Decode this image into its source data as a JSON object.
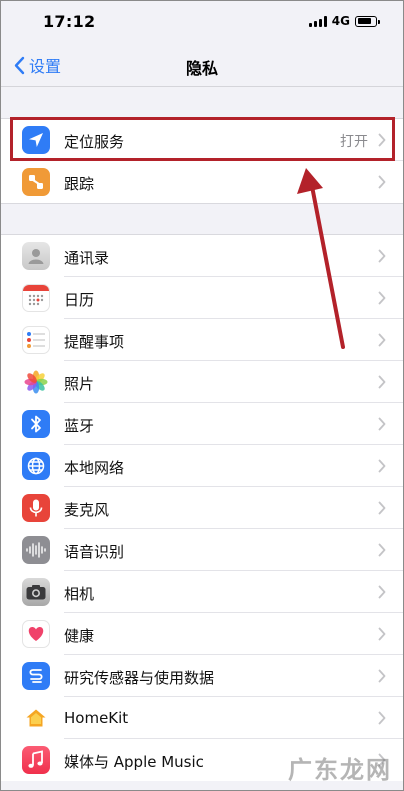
{
  "status_bar": {
    "time": "17:12",
    "network": "4G",
    "battery_level": 0.8
  },
  "nav": {
    "back_label": "设置",
    "title": "隐私"
  },
  "group1": [
    {
      "label": "定位服务",
      "value": "打开",
      "icon": "location-arrow-icon",
      "color": "#2f7cf6"
    },
    {
      "label": "跟踪",
      "value": "",
      "icon": "tracking-icon",
      "color": "#f09a37"
    }
  ],
  "group2": [
    {
      "label": "通讯录",
      "icon": "contacts-icon",
      "color": "#d8d8d8"
    },
    {
      "label": "日历",
      "icon": "calendar-icon",
      "color": "#ffffff"
    },
    {
      "label": "提醒事项",
      "icon": "reminders-icon",
      "color": "#ffffff"
    },
    {
      "label": "照片",
      "icon": "photos-icon",
      "color": "#ffffff"
    },
    {
      "label": "蓝牙",
      "icon": "bluetooth-icon",
      "color": "#2f7cf6"
    },
    {
      "label": "本地网络",
      "icon": "globe-icon",
      "color": "#2f7cf6"
    },
    {
      "label": "麦克风",
      "icon": "microphone-icon",
      "color": "#e8443a"
    },
    {
      "label": "语音识别",
      "icon": "waveform-icon",
      "color": "#8e8e93"
    },
    {
      "label": "相机",
      "icon": "camera-icon",
      "color": "#8e8e93"
    },
    {
      "label": "健康",
      "icon": "heart-icon",
      "color": "#ffffff"
    },
    {
      "label": "研究传感器与使用数据",
      "icon": "research-icon",
      "color": "#2f7cf6"
    },
    {
      "label": "HomeKit",
      "icon": "home-icon",
      "color": "#ffffff"
    },
    {
      "label": "媒体与 Apple Music",
      "icon": "music-icon",
      "color": "#f2465a"
    }
  ],
  "annotation": {
    "highlight_color": "#b3222a"
  },
  "watermark": "广东龙网"
}
